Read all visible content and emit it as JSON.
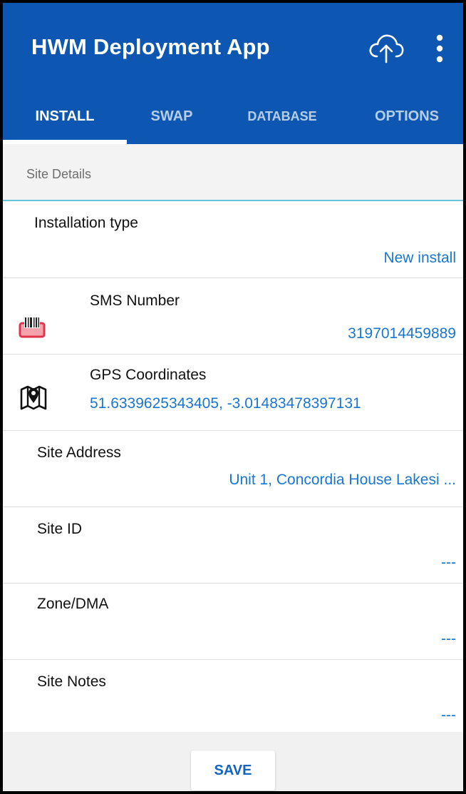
{
  "app": {
    "title": "HWM Deployment App",
    "icons": {
      "upload": "cloud-upload-icon",
      "menu": "more-vertical-icon"
    },
    "colors": {
      "primary": "#0d57b3",
      "accent_value": "#1976d2",
      "section_divider": "#6cc3dc"
    }
  },
  "tabs": [
    {
      "label": "INSTALL",
      "active": true
    },
    {
      "label": "SWAP",
      "active": false
    },
    {
      "label": "DATABASE",
      "active": false
    },
    {
      "label": "OPTIONS",
      "active": false
    }
  ],
  "section": {
    "title": "Site Details"
  },
  "rows": [
    {
      "label": "Installation type",
      "value": "New install"
    },
    {
      "label": "SMS Number",
      "value": "3197014459889",
      "icon": "sim-card-icon"
    },
    {
      "label": "GPS Coordinates",
      "value": "51.6339625343405, -3.01483478397131",
      "icon": "map-pin-icon"
    },
    {
      "label": "Site Address",
      "value": "Unit 1, Concordia House Lakesi ..."
    },
    {
      "label": "Site ID",
      "value": "---"
    },
    {
      "label": "Zone/DMA",
      "value": "---"
    },
    {
      "label": "Site Notes",
      "value": "---"
    }
  ],
  "footer": {
    "save_label": "SAVE"
  }
}
